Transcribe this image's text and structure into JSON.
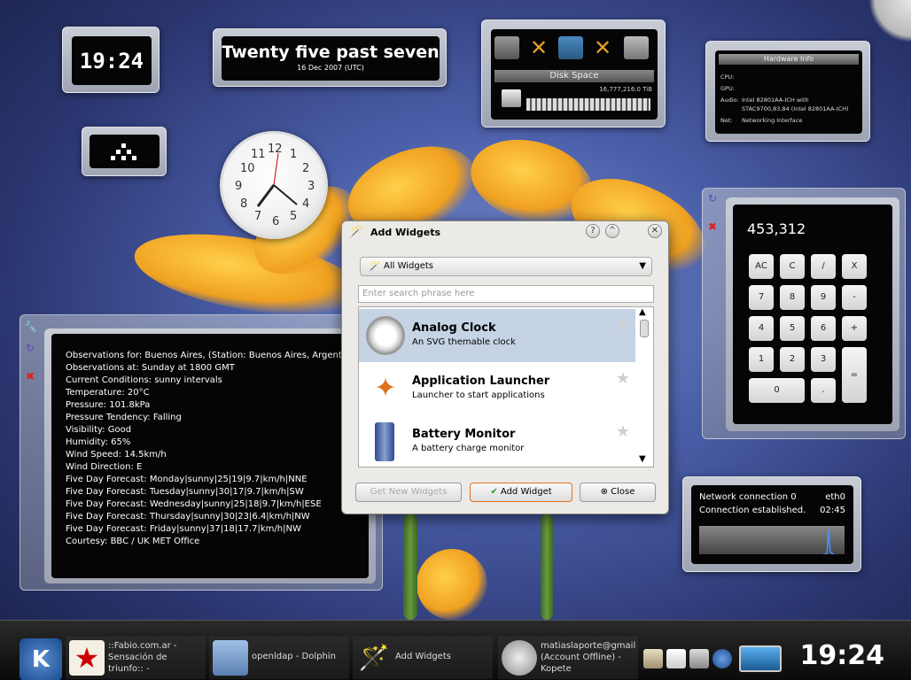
{
  "digital_clock": {
    "time": "19:24"
  },
  "fuzzy_clock": {
    "text": "Twenty five past seven",
    "date": "16 Dec 2007 (UTC)"
  },
  "disk_space": {
    "title": "Disk Space",
    "size": "16,777,216.0 TiB"
  },
  "hardware_info": {
    "title": "Hardware Info",
    "rows": [
      {
        "key": "CPU:",
        "value": ""
      },
      {
        "key": "GPU:",
        "value": ""
      },
      {
        "key": "Audio:",
        "value": "Intel 82801AA-ICH with"
      },
      {
        "key": "",
        "value": "STAC9700,83,84 (Intel 82801AA-ICH)"
      },
      {
        "key": "Net:",
        "value": "Networking Interface"
      }
    ]
  },
  "analog_clock": {
    "numbers": [
      "12",
      "1",
      "2",
      "3",
      "4",
      "5",
      "6",
      "7",
      "8",
      "9",
      "10",
      "11"
    ]
  },
  "weather": {
    "lines": [
      "Observations for: Buenos Aires,  (Station: Buenos Aires, Argentina)",
      "Observations at: Sunday at 1800 GMT",
      "Current Conditions: sunny intervals",
      "Temperature: 20°C",
      "Pressure: 101.8kPa",
      "Pressure Tendency: Falling",
      "Visibility: Good",
      "Humidity: 65%",
      "Wind Speed: 14.5km/h",
      "Wind Direction: E",
      "Five Day Forecast: Monday|sunny|25|19|9.7|km/h|NNE",
      "Five Day Forecast: Tuesday|sunny|30|17|9.7|km/h|SW",
      "Five Day Forecast: Wednesday|sunny|25|18|9.7|km/h|ESE",
      "Five Day Forecast: Thursday|sunny|30|23|6.4|km/h|NW",
      "Five Day Forecast: Friday|sunny|37|18|17.7|km/h|NW",
      "Courtesy: BBC / UK MET Office"
    ]
  },
  "calculator": {
    "display": "453,312",
    "buttons": [
      "AC",
      "C",
      "/",
      "X",
      "7",
      "8",
      "9",
      "-",
      "4",
      "5",
      "6",
      "+",
      "1",
      "2",
      "3",
      "=",
      "0",
      "."
    ]
  },
  "network": {
    "conn_label": "Network connection 0",
    "iface": "eth0",
    "status": "Connection established.",
    "time": "02:45"
  },
  "add_widgets": {
    "title": "Add Widgets",
    "filter": "All Widgets",
    "search_placeholder": "Enter search phrase here",
    "items": [
      {
        "title": "Analog Clock",
        "subtitle": "An SVG themable clock"
      },
      {
        "title": "Application Launcher",
        "subtitle": "Launcher to start applications"
      },
      {
        "title": "Battery Monitor",
        "subtitle": "A battery charge monitor"
      }
    ],
    "get_new": "Get New Widgets",
    "add": "Add Widget",
    "close": "Close"
  },
  "taskbar": {
    "tasks": [
      {
        "label": "::Fabio.com.ar - Sensación de triunfo:: -"
      },
      {
        "label": "openldap - Dolphin"
      },
      {
        "label": "Add Widgets"
      },
      {
        "label": "matiaslaporte@gmail (Account Offline) - Kopete"
      }
    ],
    "clock": "19:24"
  },
  "colors": {
    "selection": "#c6d3e4",
    "accent_orange": "#e07020"
  }
}
